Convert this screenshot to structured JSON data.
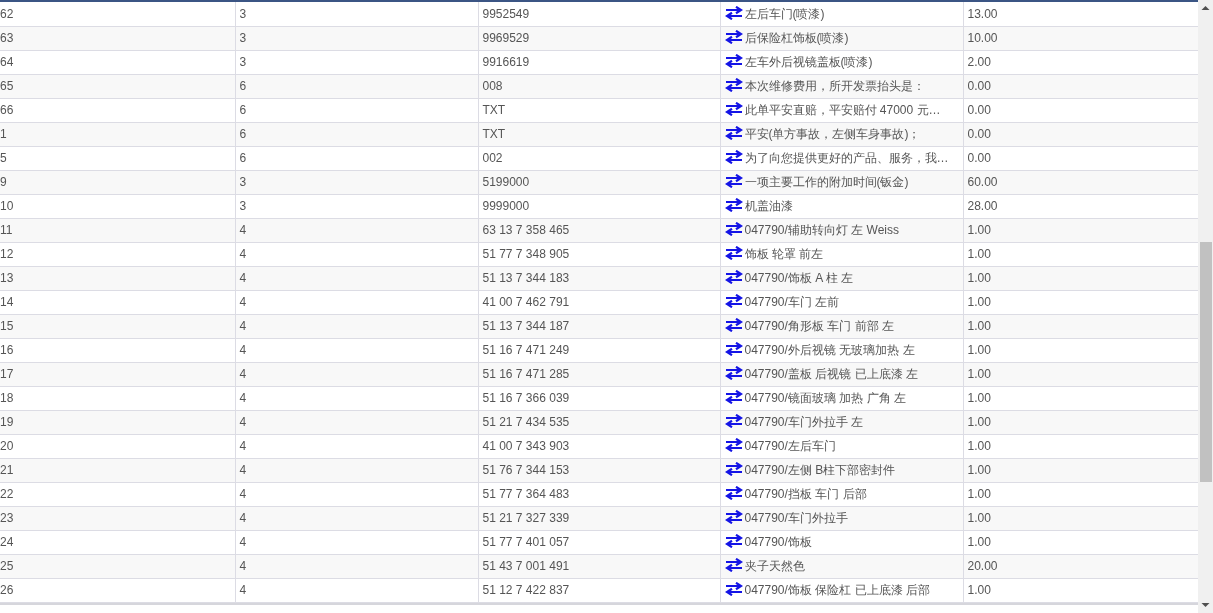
{
  "table": {
    "rows": [
      {
        "column_1": "62",
        "column_2": "3",
        "column_3": "9952549",
        "column_4": "左后车门(喷漆)",
        "column_5": "13.00"
      },
      {
        "column_1": "63",
        "column_2": "3",
        "column_3": "9969529",
        "column_4": "后保险杠饰板(喷漆)",
        "column_5": "10.00"
      },
      {
        "column_1": "64",
        "column_2": "3",
        "column_3": "9916619",
        "column_4": "左车外后视镜盖板(喷漆)",
        "column_5": "2.00"
      },
      {
        "column_1": "65",
        "column_2": "6",
        "column_3": "008",
        "column_4": "本次维修费用，所开发票抬头是：",
        "column_5": "0.00"
      },
      {
        "column_1": "66",
        "column_2": "6",
        "column_3": "TXT",
        "column_4": "此单平安直赔，平安赔付 47000 元…",
        "column_5": "0.00"
      },
      {
        "column_1": "1",
        "column_2": "6",
        "column_3": "TXT",
        "column_4": "平安(单方事故，左侧车身事故)；",
        "column_5": "0.00"
      },
      {
        "column_1": "5",
        "column_2": "6",
        "column_3": "002",
        "column_4": "为了向您提供更好的产品、服务，我…",
        "column_5": "0.00"
      },
      {
        "column_1": "9",
        "column_2": "3",
        "column_3": "5199000",
        "column_4": "一项主要工作的附加时间(钣金)",
        "column_5": "60.00"
      },
      {
        "column_1": "10",
        "column_2": "3",
        "column_3": "9999000",
        "column_4": "机盖油漆",
        "column_5": "28.00"
      },
      {
        "column_1": "11",
        "column_2": "4",
        "column_3": "63 13 7 358 465",
        "column_4": "047790/辅助转向灯 左 Weiss",
        "column_5": "1.00"
      },
      {
        "column_1": "12",
        "column_2": "4",
        "column_3": "51 77 7 348 905",
        "column_4": "饰板 轮罩 前左",
        "column_5": "1.00"
      },
      {
        "column_1": "13",
        "column_2": "4",
        "column_3": "51 13 7 344 183",
        "column_4": "047790/饰板 A 柱 左",
        "column_5": "1.00"
      },
      {
        "column_1": "14",
        "column_2": "4",
        "column_3": "41 00 7 462 791",
        "column_4": "047790/车门 左前",
        "column_5": "1.00"
      },
      {
        "column_1": "15",
        "column_2": "4",
        "column_3": "51 13 7 344 187",
        "column_4": "047790/角形板 车门 前部 左",
        "column_5": "1.00"
      },
      {
        "column_1": "16",
        "column_2": "4",
        "column_3": "51 16 7 471 249",
        "column_4": "047790/外后视镜 无玻璃加热 左",
        "column_5": "1.00"
      },
      {
        "column_1": "17",
        "column_2": "4",
        "column_3": "51 16 7 471 285",
        "column_4": "047790/盖板 后视镜 已上底漆 左",
        "column_5": "1.00"
      },
      {
        "column_1": "18",
        "column_2": "4",
        "column_3": "51 16 7 366 039",
        "column_4": "047790/镜面玻璃 加热 广角 左",
        "column_5": "1.00"
      },
      {
        "column_1": "19",
        "column_2": "4",
        "column_3": "51 21 7 434 535",
        "column_4": "047790/车门外拉手 左",
        "column_5": "1.00"
      },
      {
        "column_1": "20",
        "column_2": "4",
        "column_3": "41 00 7 343 903",
        "column_4": "047790/左后车门",
        "column_5": "1.00"
      },
      {
        "column_1": "21",
        "column_2": "4",
        "column_3": "51 76 7 344 153",
        "column_4": "047790/左侧 B柱下部密封件",
        "column_5": "1.00"
      },
      {
        "column_1": "22",
        "column_2": "4",
        "column_3": "51 77 7 364 483",
        "column_4": "047790/挡板 车门 后部",
        "column_5": "1.00"
      },
      {
        "column_1": "23",
        "column_2": "4",
        "column_3": "51 21 7 327 339",
        "column_4": "047790/车门外拉手",
        "column_5": "1.00"
      },
      {
        "column_1": "24",
        "column_2": "4",
        "column_3": "51 77 7 401 057",
        "column_4": "047790/饰板",
        "column_5": "1.00"
      },
      {
        "column_1": "25",
        "column_2": "4",
        "column_3": "51 43 7 001 491",
        "column_4": "夹子天然色",
        "column_5": "20.00"
      },
      {
        "column_1": "26",
        "column_2": "4",
        "column_3": "51 12 7 422 837",
        "column_4": "047790/饰板 保险杠 已上底漆 后部",
        "column_5": "1.00"
      }
    ]
  }
}
